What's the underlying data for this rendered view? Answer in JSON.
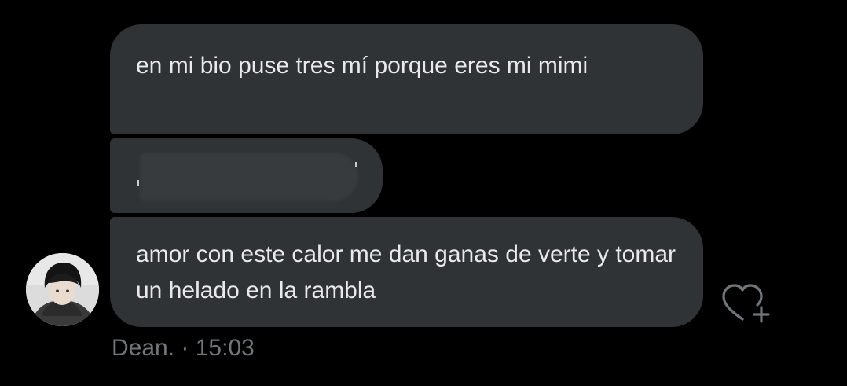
{
  "conversation": {
    "messages": [
      {
        "text": "en mi bio puse tres mí porque eres mi mimi"
      },
      {
        "text": "",
        "redacted": true
      },
      {
        "text": "amor con este calor me dan ganas de verte y tomar un helado en la rambla"
      }
    ],
    "sender": {
      "name": "Dean.",
      "separator": " · ",
      "time": "15:03",
      "avatar_icon": "user-photo"
    },
    "reaction_icon": "heart-plus-icon"
  },
  "theme": {
    "background": "#000000",
    "bubble": "#2f3336",
    "text": "#e7e9ea",
    "meta_text": "#71767b"
  }
}
